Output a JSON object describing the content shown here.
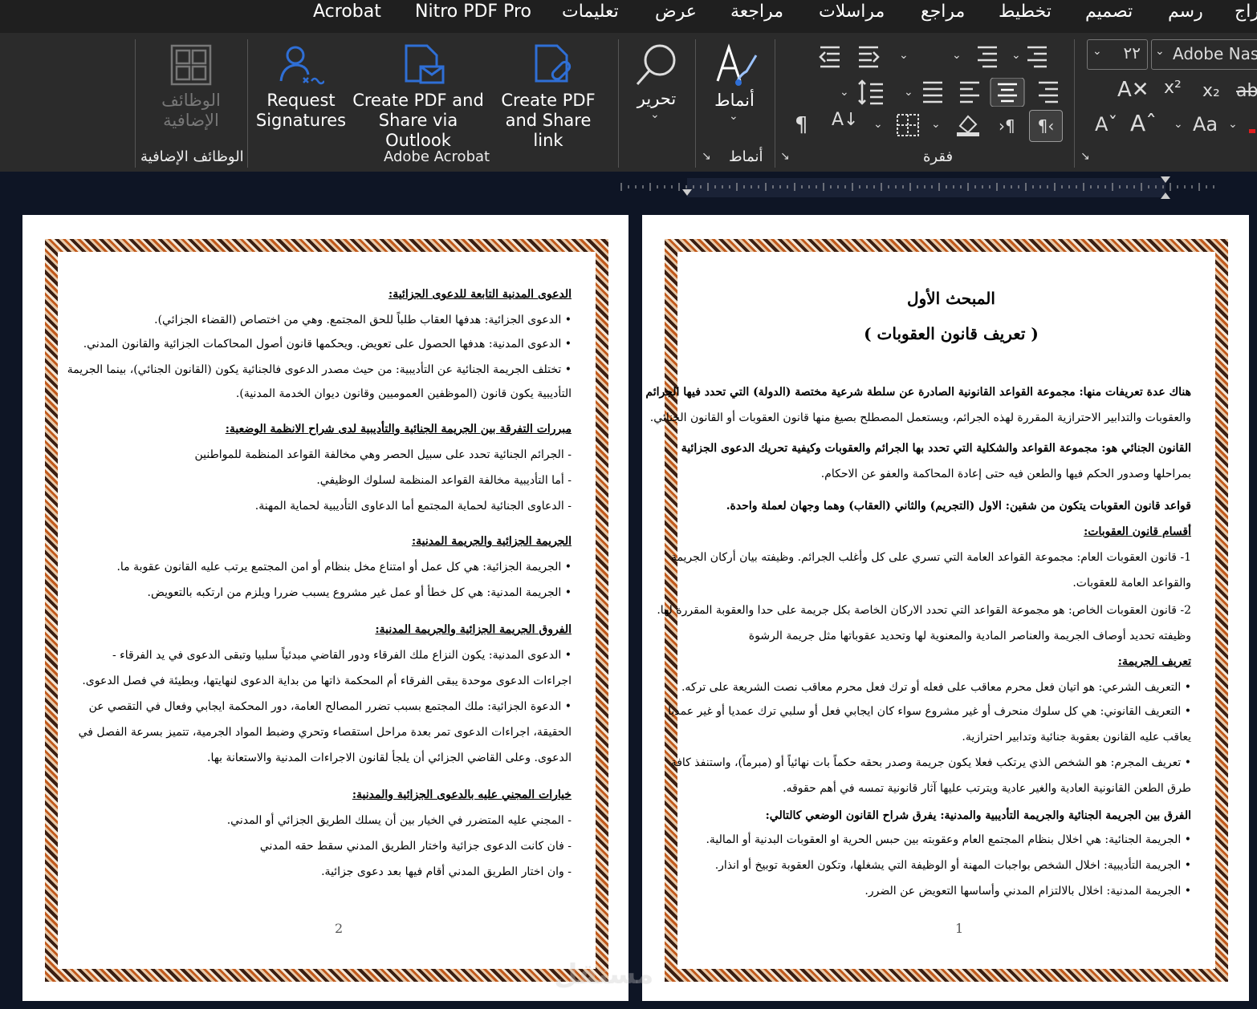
{
  "menubar": {
    "tabs": [
      "Acrobat",
      "Nitro PDF Pro",
      "تعليمات",
      "عرض",
      "مراجعة",
      "مراسلات",
      "مراجع",
      "تخطيط",
      "تصميم",
      "رسم",
      "إدراج"
    ]
  },
  "ribbon": {
    "addins": {
      "button": "الوظائف الإضافية",
      "group": "الوظائف الإضافية"
    },
    "acrobat": {
      "request_signatures": "Request Signatures",
      "outlook": "Create PDF and Share via Outlook",
      "share_link": "Create PDF and Share link",
      "group": "Adobe Acrobat"
    },
    "edit": {
      "label": "تحرير"
    },
    "styles": {
      "button": "أنماط",
      "group": "أنماط"
    },
    "paragraph": {
      "group": "فقرة"
    },
    "font": {
      "size": "٢٢",
      "name": "Adobe Nask",
      "case": "Aa"
    }
  },
  "page1": {
    "title": "المبحث الأول",
    "subtitle": "( تعريف قانون العقوبات )",
    "number": "1",
    "lines": [
      {
        "t": "هناك عدة تعريفات منها: مجموعة القواعد القانونية الصادرة عن سلطة شرعية مختصة (الدولة) التي تحدد فيها الجرائم",
        "b": true
      },
      {
        "t": "والعقوبات والتدابير الاحترازية المقررة لهذه الجرائم، ويستعمل المصطلح بصيغ منها قانون العقوبات أو القانون الجنائي."
      },
      {
        "t": "القانون الجنائي هو: مجموعة القواعد والشكلية التي تحدد بها الجرائم والعقوبات وكيفية تحريك الدعوى الجزائية",
        "b": true
      },
      {
        "t": "بمراحلها وصدور الحكم فيها والطعن فيه حتى إعادة المحاكمة والعفو عن الاحكام."
      },
      {
        "t": "قواعد قانون العقوبات يتكون من شقين: الاول (التجريم) والثاني (العقاب) وهما وجهان لعملة واحدة.",
        "b": true
      },
      {
        "t": "أقسام قانون العقوبات:",
        "b": true,
        "u": true
      },
      {
        "t": "1- قانون العقوبات العام: مجموعة القواعد العامة التي تسري على كل وأغلب الجرائم. وظيفته بيان أركان الجريمة"
      },
      {
        "t": "والقواعد العامة للعقوبات."
      },
      {
        "t": "2- قانون العقوبات الخاص: هو مجموعة القواعد التي تحدد الاركان الخاصة بكل جريمة على حدا والعقوبة المقررة لها."
      },
      {
        "t": "وظيفته تحديد أوصاف الجريمة والعناصر المادية والمعنوية لها وتحديد عقوباتها مثل جريمة الرشوة"
      },
      {
        "t": "تعريف الجريمة:",
        "b": true,
        "u": true
      },
      {
        "t": "• التعريف الشرعي: هو اتيان فعل محرم معاقب على فعله أو ترك فعل محرم معاقب نصت الشريعة على تركه."
      },
      {
        "t": "• التعريف القانوني: هي كل سلوك منحرف أو غير مشروع سواء كان ايجابي فعل أو سلبي ترك عمديا أو غير عمديا"
      },
      {
        "t": "يعاقب عليه القانون بعقوبة جنائية وتدابير احترازية."
      },
      {
        "t": "• تعريف المجرم: هو الشخص الذي يرتكب فعلا يكون جريمة وصدر بحقه حكماً بات نهائياً أو (مبرماً)، واستنفذ كافة"
      },
      {
        "t": "طرق الطعن القانونية العادية والغير عادية ويترتب عليها آثار قانونية تمسه في أهم حقوقه."
      },
      {
        "t": "الفرق بين الجريمة الجنائية والجريمة التأديبية والمدنية: يفرق شراح القانون الوضعي كالتالي:",
        "b": true
      },
      {
        "t": "• الجريمة الجنائية: هي اخلال بنظام المجتمع العام وعقوبته بين حبس الحرية او العقوبات البدنية أو المالية."
      },
      {
        "t": "• الجريمة التأديبية: اخلال الشخص بواجبات المهنة أو الوظيفة التي يشغلها، وتكون العقوبة توبيخ أو انذار."
      },
      {
        "t": "• الجريمة المدنية: اخلال بالالتزام المدني وأساسها التعويض عن الضرر."
      }
    ]
  },
  "page2": {
    "number": "2",
    "lines": [
      {
        "t": "الدعوى المدنية التابعة للدعوى الجزائية:",
        "b": true,
        "u": true
      },
      {
        "t": "• الدعوى الجزائية: هدفها العقاب طلباً للحق المجتمع. وهي من اختصاص (القضاء الجزائي)."
      },
      {
        "t": "• الدعوى المدنية: هدفها الحصول على تعويض. ويحكمها قانون أصول المحاكمات الجزائية والقانون المدني."
      },
      {
        "t": "• تختلف الجريمة الجنائية عن التأديبية: من حيث مصدر الدعوى فالجنائية يكون (القانون الجنائي)، بينما الجريمة"
      },
      {
        "t": "التأديبية يكون قانون (الموظفين العموميين وقانون ديوان الخدمة المدنية)."
      },
      {
        "t": "مبررات التفرقة بين الجريمة الجنائية والتأديبية لدى شراح الانظمة الوضعية:",
        "b": true,
        "u": true
      },
      {
        "t": "-    الجرائم الجنائية تحدد على سبيل الحصر وهي مخالفة القواعد المنظمة للمواطنين"
      },
      {
        "t": "-    أما التأديبية مخالفة القواعد المنظمة لسلوك الوظيفي."
      },
      {
        "t": "-    الدعاوى الجنائية لحماية المجتمع أما الدعاوى التأديبية لحماية المهنة."
      },
      {
        "t": "الجريمة الجزائية والجريمة المدنية:",
        "b": true,
        "u": true
      },
      {
        "t": "•    الجريمة الجزائية: هي كل عمل أو امتناع مخل بنظام أو امن المجتمع يرتب عليه القانون عقوبة ما."
      },
      {
        "t": "•    الجريمة المدنية: هي كل خطأ أو عمل غير مشروع يسبب ضررا ويلزم من ارتكبه بالتعويض."
      },
      {
        "t": "الفروق الجريمة الجزائية والجريمة المدنية:",
        "b": true,
        "u": true
      },
      {
        "t": "•    الدعوى المدنية: يكون النزاع ملك الفرقاء ودور القاضي مبدئياً سلبيا وتبقى الدعوى في يد الفرقاء -"
      },
      {
        "t": "اجراءات الدعوى موحدة يبقى الفرقاء أم المحكمة ذاتها من بداية الدعوى لنهايتها، وبطيئة في فصل الدعوى."
      },
      {
        "t": "•    الدعوة الجزائية: ملك المجتمع بسبب تضرر المصالح العامة، دور المحكمة ايجابي وفعال في التقصي عن"
      },
      {
        "t": "الحقيقة، اجراءات الدعوى تمر بعدة مراحل استقصاء وتحري وضبط المواد الجرمية، تتميز بسرعة الفصل في"
      },
      {
        "t": "الدعوى. وعلى القاضي الجزائي أن يلجأ لقانون الاجراءات المدنية والاستعانة بها."
      },
      {
        "t": "خيارات المجني عليه بالدعوى الجزائية والمدنية:",
        "b": true,
        "u": true
      },
      {
        "t": "-    المجني عليه المتضرر في الخيار بين أن يسلك الطريق الجزائي أو المدني."
      },
      {
        "t": "-    فان كانت الدعوى جزائية واختار الطريق المدني سقط حقه المدني"
      },
      {
        "t": "-    وان اختار الطريق المدني أقام فيها بعد دعوى جزائية."
      }
    ]
  },
  "colors": {
    "ribbon": "#2b2b2b",
    "menubar": "#1f1f1f",
    "accent": "#2f6fd6",
    "background": "#0e1525"
  },
  "watermark": "مستقل"
}
